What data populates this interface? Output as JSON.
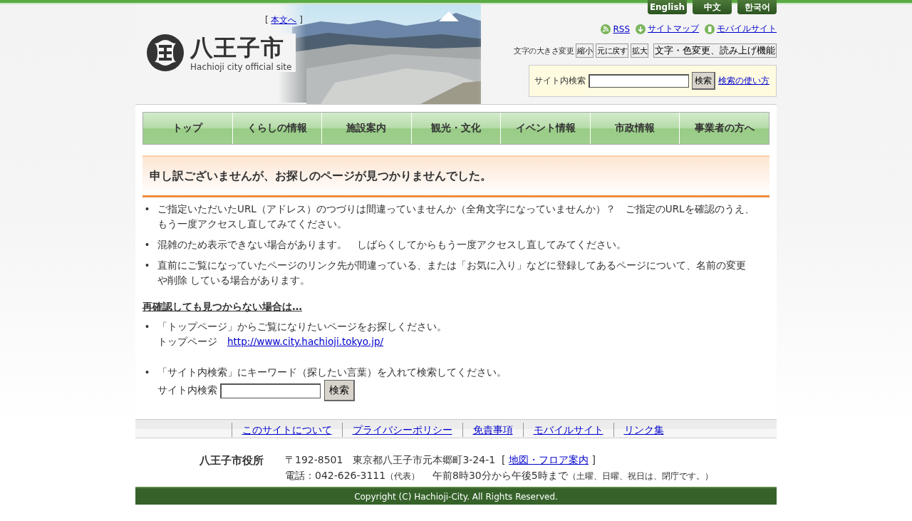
{
  "header": {
    "skip_brackets": [
      "[",
      "]"
    ],
    "skip_link": "本文へ",
    "logo_title": "八王子市",
    "logo_subtitle": "Hachioji city official site",
    "languages": [
      "English",
      "中文",
      "한국어"
    ],
    "links": [
      {
        "kind": "rss",
        "label": "RSS"
      },
      {
        "kind": "sitemap",
        "label": "サイトマップ"
      },
      {
        "kind": "mobile",
        "label": "モバイルサイト"
      }
    ],
    "font_size_label": "文字の大きさ変更",
    "font_size_buttons": [
      "縮小",
      "元に戻す",
      "拡大"
    ],
    "accessibility_button": "文字・色変更、読み上げ機能",
    "search": {
      "label": "サイト内検索",
      "button": "検索",
      "help_link": "検索の使い方"
    }
  },
  "nav": [
    "トップ",
    "くらしの情報",
    "施設案内",
    "観光・文化",
    "イベント情報",
    "市政情報",
    "事業者の方へ"
  ],
  "error_title": "申し訳ございませんが、お探しのページが見つかりませんでした。",
  "reasons": [
    "ご指定いただいたURL（アドレス）のつづりは間違っていませんか（全角文字になっていませんか）？　ご指定のURLを確認のうえ、もう一度アクセスし直してみてください。",
    "混雑のため表示できない場合があります。　しばらくしてからもう一度アクセスし直してみてください。",
    "直前にご覧になっていたページのリンク先が間違っている、または「お気に入り」などに登録してあるページについて、名前の変更や削除 している場合があります。"
  ],
  "bullet": "•",
  "subheading": "再確認しても見つからない場合は…",
  "suggestions": [
    {
      "kind": "link",
      "text": "「トップページ」からご覧になりたいページをお探しください。",
      "label": "トップページ",
      "link": "http://www.city.hachioji.tokyo.jp/"
    },
    {
      "kind": "search",
      "text": "「サイト内検索」にキーワード（探したい言葉）を入れて検索してください。",
      "label": "サイト内検索",
      "button": "検索"
    }
  ],
  "footer": {
    "links": [
      "このサイトについて",
      "プライバシーポリシー",
      "免責事項",
      "モバイルサイト",
      "リンク集"
    ],
    "office": "八王子市役所",
    "address": "〒192-8501　東京都八王子市元本郷町3-24-1",
    "map_brackets": [
      "[",
      "]"
    ],
    "map_link": "地図・フロア案内",
    "phone": "電話：042-626-3111",
    "phone_note": "（代表）",
    "hours": "午前8時30分から午後5時まで",
    "hours_note": "（土曜、日曜、祝日は、閉庁です。）",
    "copyright": "Copyright (C) Hachioji-City. All Rights Reserved."
  }
}
